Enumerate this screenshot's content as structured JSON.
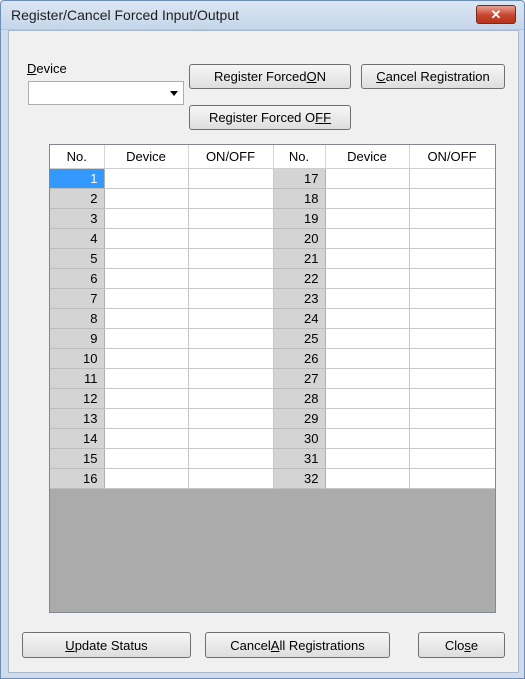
{
  "window": {
    "title": "Register/Cancel Forced Input/Output",
    "close_label": "✕"
  },
  "device_label_first": "D",
  "device_label_rest": "evice",
  "device_combo_value": "",
  "buttons": {
    "register_on_pre": "Register Forced ",
    "register_on_ul": "O",
    "register_on_post": "N",
    "register_off_pre": "Register Forced O",
    "register_off_ul": "F",
    "register_off_post": "F",
    "cancel_reg_ul": "C",
    "cancel_reg_post": "ancel Registration",
    "update_ul": "U",
    "update_post": "pdate Status",
    "cancel_all_pre": "Cancel ",
    "cancel_all_ul": "A",
    "cancel_all_post": "ll Registrations",
    "close_pre": "Clo",
    "close_ul": "s",
    "close_post": "e"
  },
  "table": {
    "headers": [
      "No.",
      "Device",
      "ON/OFF",
      "No.",
      "Device",
      "ON/OFF"
    ],
    "left_numbers": [
      "1",
      "2",
      "3",
      "4",
      "5",
      "6",
      "7",
      "8",
      "9",
      "10",
      "11",
      "12",
      "13",
      "14",
      "15",
      "16"
    ],
    "right_numbers": [
      "17",
      "18",
      "19",
      "20",
      "21",
      "22",
      "23",
      "24",
      "25",
      "26",
      "27",
      "28",
      "29",
      "30",
      "31",
      "32"
    ],
    "selected_row": 0
  }
}
